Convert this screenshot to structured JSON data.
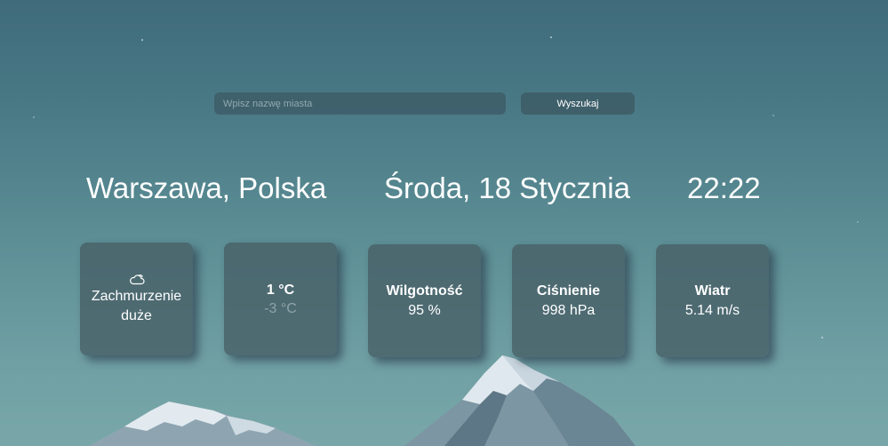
{
  "search": {
    "placeholder": "Wpisz nazwę miasta",
    "button_label": "Wyszukaj"
  },
  "header": {
    "location": "Warszawa, Polska",
    "date": "Środa, 18 Stycznia",
    "time": "22:22"
  },
  "cards": {
    "condition": {
      "icon": "cloud-icon",
      "label": "Zachmurzenie duże"
    },
    "temperature": {
      "current": "1 °C",
      "feels_like": "-3 °C"
    },
    "humidity": {
      "title": "Wilgotność",
      "value": "95 %"
    },
    "pressure": {
      "title": "Ciśnienie",
      "value": "998 hPa"
    },
    "wind": {
      "title": "Wiatr",
      "value": "5.14 m/s"
    }
  },
  "colors": {
    "sky_top": "#3f6b7b",
    "sky_bottom": "#79a7a9",
    "card_bg": "#486068",
    "text": "#ffffff",
    "muted_text": "#8ea3a9"
  }
}
